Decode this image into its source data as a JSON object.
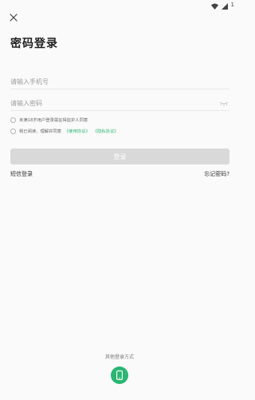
{
  "status_bar": {
    "battery_text": "1"
  },
  "title": "密码登录",
  "phone_field": {
    "placeholder": "请输入手机号",
    "value": ""
  },
  "password_field": {
    "placeholder": "请输入密码",
    "value": ""
  },
  "minor_consent": {
    "text": "未满18岁用户登录需征得监护人同意"
  },
  "agreement": {
    "prefix": "我已阅读、理解并同意",
    "user_agreement": "《使用协议》",
    "privacy_policy": "《隐私协议》"
  },
  "login_button_label": "登录",
  "sms_login_label": "短信登录",
  "forgot_password_label": "忘记密码?",
  "other_methods_label": "其他登录方式",
  "colors": {
    "accent": "#2bb673",
    "disabled_button": "#d9d9d9"
  }
}
